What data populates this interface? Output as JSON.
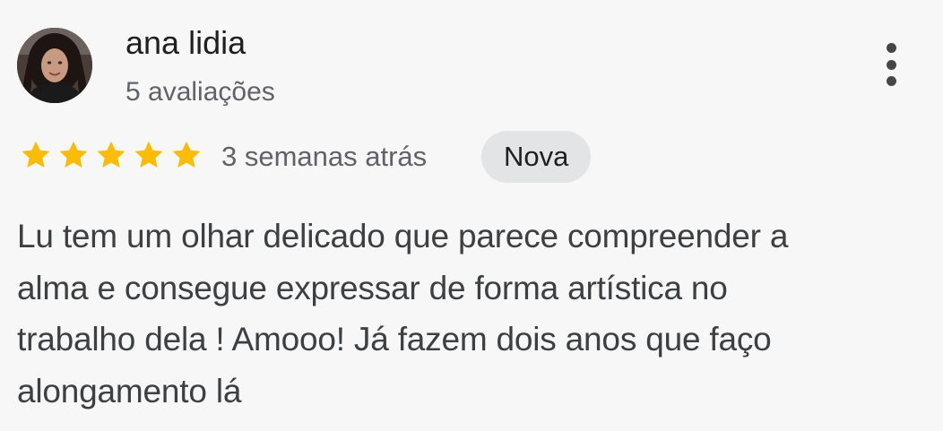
{
  "review": {
    "author": {
      "name": "ana lidia",
      "meta": "5 avaliações",
      "avatar_icon": "user-avatar-photo"
    },
    "more_icon": "more-vertical-icon",
    "rating": {
      "stars": 5,
      "max": 5,
      "star_color": "#fbbc04"
    },
    "date": "3 semanas atrás",
    "badge": "Nova",
    "text_lines": [
      "Lu tem um olhar delicado que parece compreender a",
      "alma e consegue expressar de forma artística no",
      "trabalho dela ! Amooo! Já fazem dois anos que faço",
      "alongamento lá"
    ]
  }
}
